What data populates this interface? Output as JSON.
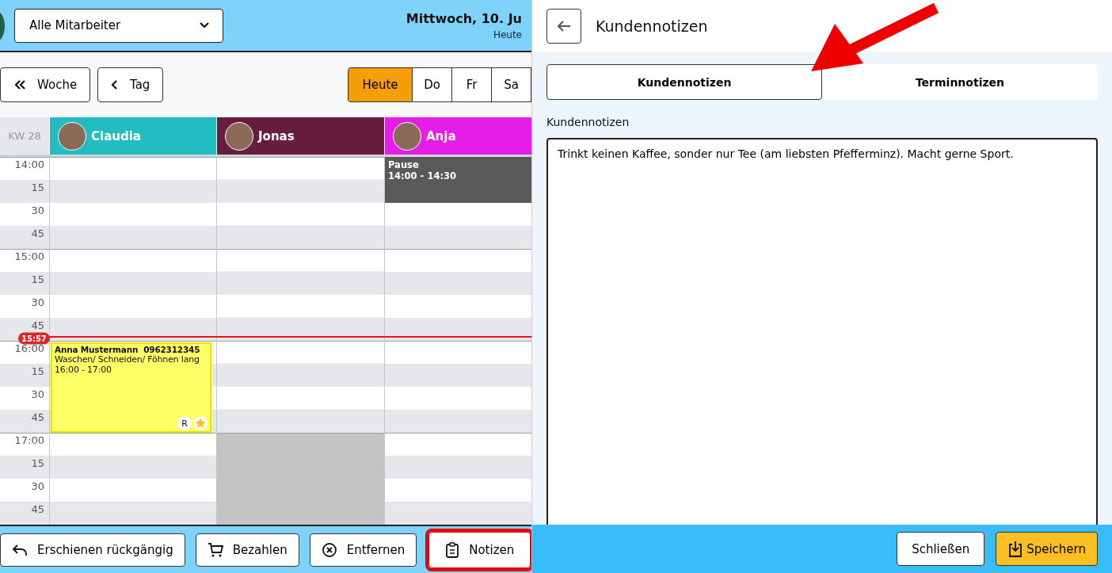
{
  "calendar_pane": {
    "staff_filter": {
      "value": "Alle Mitarbeiter"
    },
    "date_title": "Mittwoch, 10. Ju",
    "date_subtitle": "Heute",
    "nav_buttons": [
      {
        "kind": "week",
        "label": "Woche"
      },
      {
        "kind": "day",
        "label": "Tag"
      }
    ],
    "day_tabs": [
      {
        "label": "Heute",
        "selected": true
      },
      {
        "label": "Do",
        "selected": false
      },
      {
        "label": "Fr",
        "selected": false
      },
      {
        "label": "Sa",
        "selected": false
      }
    ],
    "week_label": "KW 28",
    "times": [
      "14:00",
      "15",
      "30",
      "45",
      "15:00",
      "15",
      "30",
      "45",
      "16:00",
      "15",
      "30",
      "45",
      "17:00",
      "15",
      "30",
      "45"
    ],
    "now": "15:57",
    "staff": [
      {
        "name": "Claudia",
        "color": "#22bdc2",
        "events": [
          {
            "kind": "appointment",
            "customer": "Anna Mustermann",
            "phone": "0962312345",
            "service": "Waschen/ Schneiden/ Föhnen lang",
            "time": "16:00 - 17:00",
            "badge": "R",
            "starred": true
          }
        ]
      },
      {
        "name": "Jonas",
        "color": "#671e3b",
        "cells": [
          {
            "blocked": false
          },
          {
            "blocked": false
          },
          {
            "blocked": false
          },
          {
            "blocked": false
          },
          {
            "blocked": false
          },
          {
            "blocked": false
          },
          {
            "blocked": false
          },
          {
            "blocked": false
          },
          {
            "blocked": false
          },
          {
            "blocked": false
          },
          {
            "blocked": false
          },
          {
            "blocked": false
          },
          {
            "blocked": true
          },
          {
            "blocked": true
          },
          {
            "blocked": true
          },
          {
            "blocked": true
          }
        ]
      },
      {
        "name": "Anja",
        "color": "#e41ee6",
        "events": [
          {
            "kind": "break",
            "title": "Pause",
            "time": "14:00 - 14:30"
          }
        ]
      }
    ],
    "actions": [
      {
        "kind": "undo",
        "label": "Erschienen rückgängig",
        "highlighted": false
      },
      {
        "kind": "cart",
        "label": "Bezahlen",
        "highlighted": false
      },
      {
        "kind": "remove",
        "label": "Entfernen",
        "highlighted": false
      },
      {
        "kind": "notes",
        "label": "Notizen",
        "highlighted": true
      }
    ]
  },
  "notes_pane": {
    "title": "Kundennotizen",
    "tabs": [
      {
        "label": "Kundennotizen",
        "selected": true
      },
      {
        "label": "Terminnotizen",
        "selected": false
      }
    ],
    "field_label": "Kundennotizen",
    "notes_value": "Trinkt keinen Kaffee, sonder nur Tee (am liebsten Pfefferminz). Macht gerne Sport.",
    "buttons": [
      {
        "kind": "close",
        "label": "Schließen"
      },
      {
        "kind": "save",
        "label": "Speichern"
      }
    ]
  }
}
